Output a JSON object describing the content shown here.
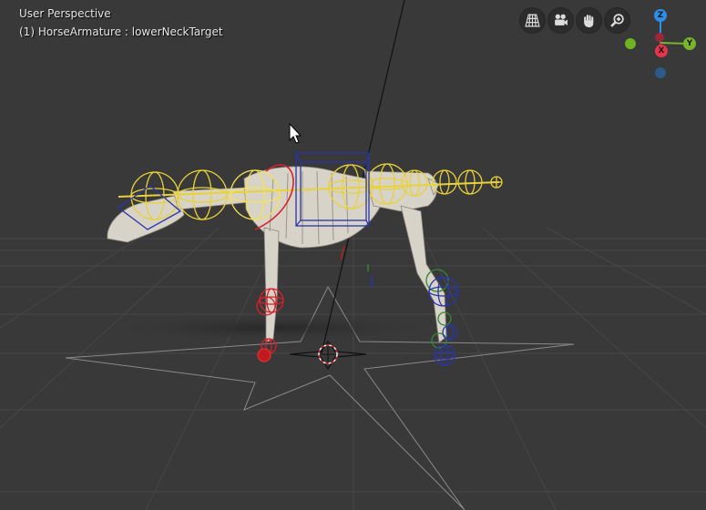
{
  "viewport": {
    "perspective_label": "User Perspective",
    "object_info": "(1) HorseArmature : lowerNeckTarget"
  },
  "navigation": {
    "buttons": [
      {
        "icon": "grid-perspective-icon"
      },
      {
        "icon": "camera-icon"
      },
      {
        "icon": "hand-pan-icon"
      },
      {
        "icon": "zoom-icon"
      }
    ]
  },
  "axis_gizmo": {
    "z_label": "Z",
    "y_label": "Y",
    "x_label": "X",
    "colors": {
      "x": "#e8344b",
      "y": "#77b52b",
      "z": "#2c8ee8",
      "neg_x": "#9b2737",
      "neg_y": "#6fb222",
      "neg_z": "#2c5b8a"
    }
  },
  "colors": {
    "background": "#393939",
    "grid": "#4a4a4a",
    "bone_yellow": "#e8d23a",
    "ik_red": "#d8202a",
    "ik_blue": "#2a34a8",
    "ik_green": "#2f8a2f",
    "skeleton": "#d8d3c8"
  }
}
